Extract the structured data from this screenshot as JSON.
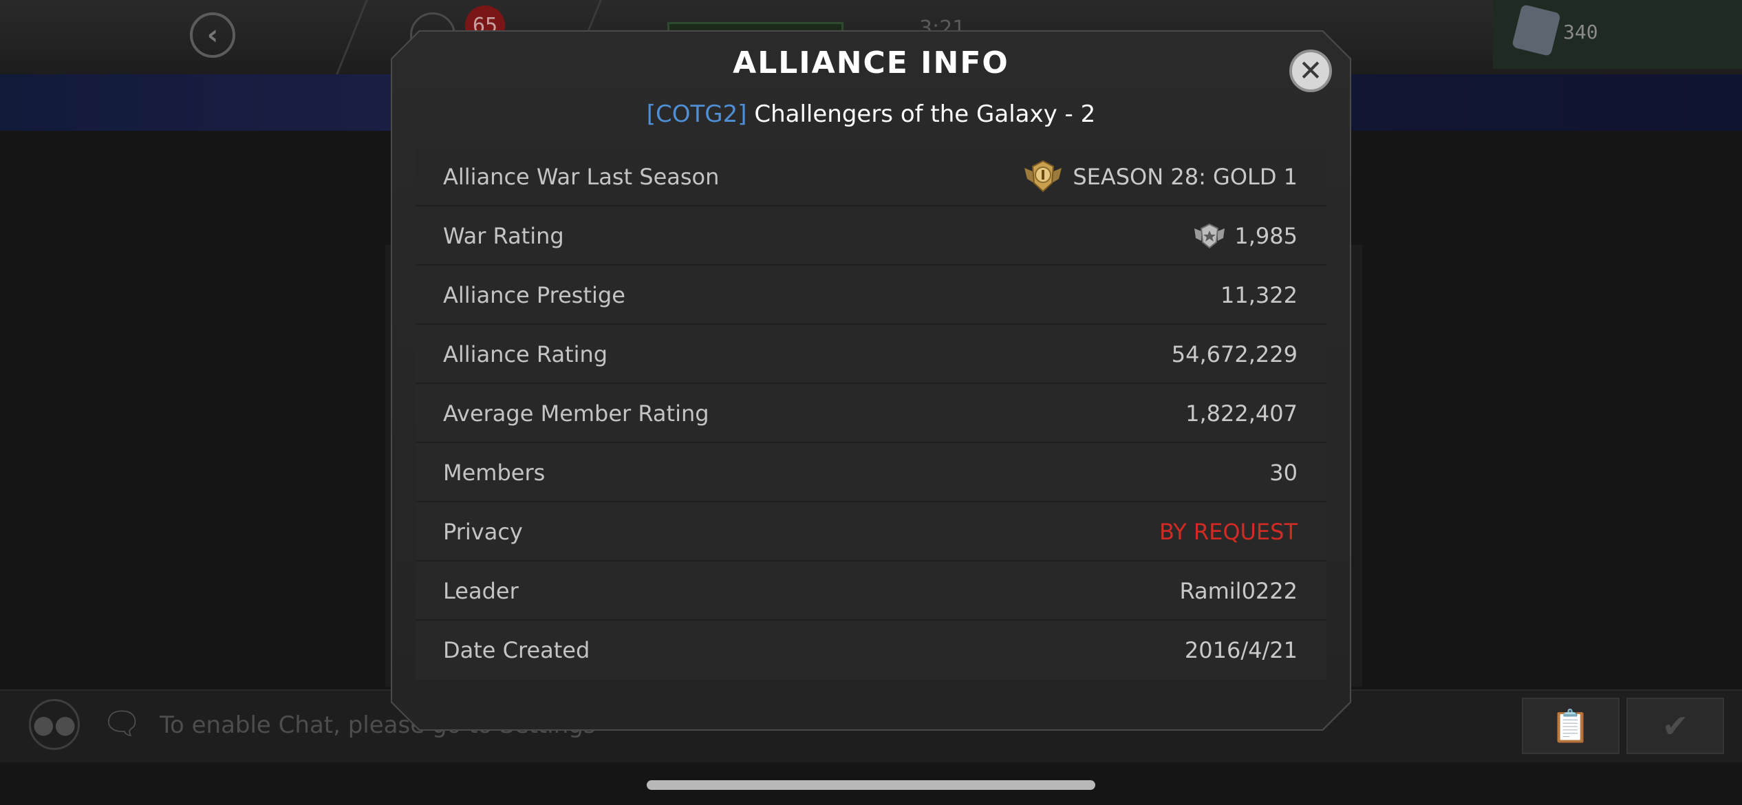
{
  "background": {
    "notification_count": "65",
    "units_value": "340",
    "timer_text": "3:21",
    "chat_placeholder": "To enable Chat, please go to Settings"
  },
  "modal": {
    "title": "ALLIANCE INFO",
    "alliance_tag": "[COTG2]",
    "alliance_name": "Challengers of the Galaxy - 2",
    "rows": [
      {
        "label": "Alliance War Last Season",
        "value": "SEASON 28: GOLD 1",
        "icon": "gold-tier-icon"
      },
      {
        "label": "War Rating",
        "value": "1,985",
        "icon": "war-rating-icon"
      },
      {
        "label": "Alliance Prestige",
        "value": "11,322"
      },
      {
        "label": "Alliance Rating",
        "value": "54,672,229"
      },
      {
        "label": "Average Member Rating",
        "value": "1,822,407"
      },
      {
        "label": "Members",
        "value": "30"
      },
      {
        "label": "Privacy",
        "value": "BY REQUEST",
        "value_color": "#d42a24"
      },
      {
        "label": "Leader",
        "value": "Ramil0222"
      },
      {
        "label": "Date Created",
        "value": "2016/4/21"
      }
    ]
  },
  "colors": {
    "tag_blue": "#4f8fd6",
    "privacy_red": "#d42a24",
    "modal_bg": "#262626"
  }
}
